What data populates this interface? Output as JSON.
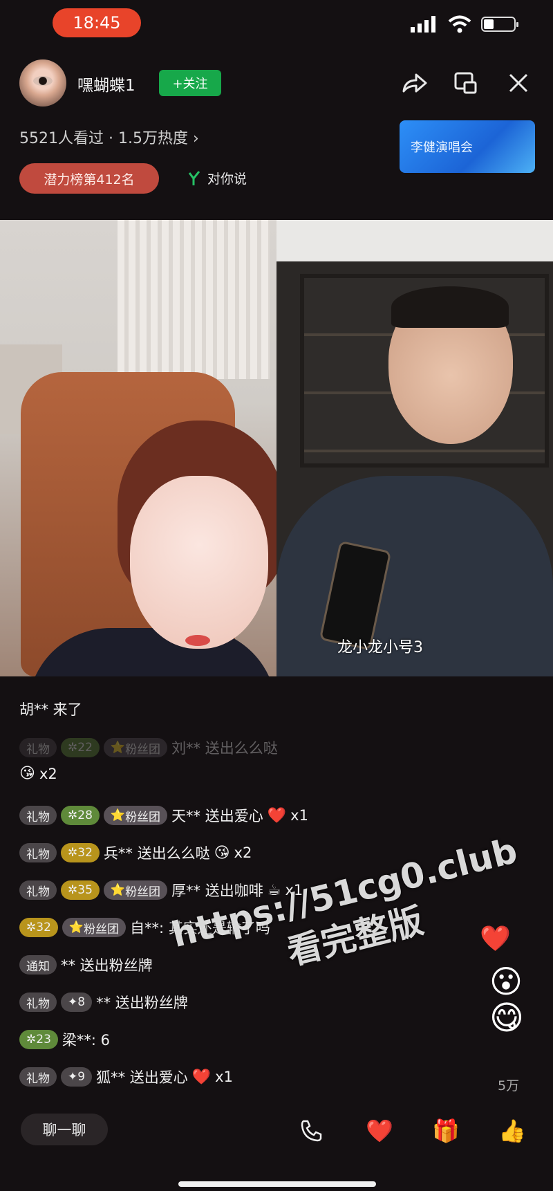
{
  "status": {
    "time": "18:45"
  },
  "header": {
    "host_name": "嘿蝴蝶1",
    "follow_label": "+关注",
    "viewers": "5521人看过",
    "heat": "1.5万热度",
    "rank_badge": "潜力榜第412名",
    "say_to_you": "对你说",
    "concert_card": "李健演唱会"
  },
  "video": {
    "streamer_label": "龙小龙小号3"
  },
  "chat": [
    {
      "text": "胡**  来了"
    },
    {
      "gift": "礼物",
      "level": "22",
      "fan": "粉丝团",
      "text": "刘**  送出么么哒"
    },
    {
      "emoji": "😘",
      "count": "x2"
    },
    {
      "gift": "礼物",
      "level": "28",
      "fan": "粉丝团",
      "text": "天**  送出爱心",
      "emoji": "❤️",
      "count": "x1"
    },
    {
      "gift": "礼物",
      "level": "32",
      "text": "兵**  送出么么哒",
      "emoji": "😘",
      "count": "x2"
    },
    {
      "gift": "礼物",
      "level": "35",
      "fan": "粉丝团",
      "text": "厚**  送出咖啡",
      "emoji": "☕",
      "count": "x1"
    },
    {
      "level": "32",
      "fan": "粉丝团",
      "text": "自**:  其实还是输了吗"
    },
    {
      "notice": "通知",
      "text": "**  送出粉丝牌"
    },
    {
      "gift": "礼物",
      "level": "8",
      "text": "**  送出粉丝牌"
    },
    {
      "level": "23",
      "text": "梁**:  6"
    },
    {
      "gift": "礼物",
      "level": "9",
      "text": "狐**  送出爱心",
      "emoji": "❤️",
      "count": "x1"
    }
  ],
  "side": {
    "like_count": "5万"
  },
  "bottom": {
    "chat_label": "聊一聊"
  },
  "watermark": {
    "line1": "https://51cg0.club",
    "line2": "看完整版"
  },
  "icons": [
    "signal-icon",
    "wifi-icon",
    "battery-icon",
    "share-icon",
    "screen-icon",
    "close-icon",
    "chevron-right-icon",
    "mic-icon",
    "call-icon",
    "heart-icon",
    "gift-icon",
    "thumbs-up-icon"
  ],
  "colors": {
    "accent_red": "#e8442a",
    "follow_green": "#17a84a",
    "rank_red": "#c04a3e",
    "card_blue": "#2d8ff7"
  }
}
